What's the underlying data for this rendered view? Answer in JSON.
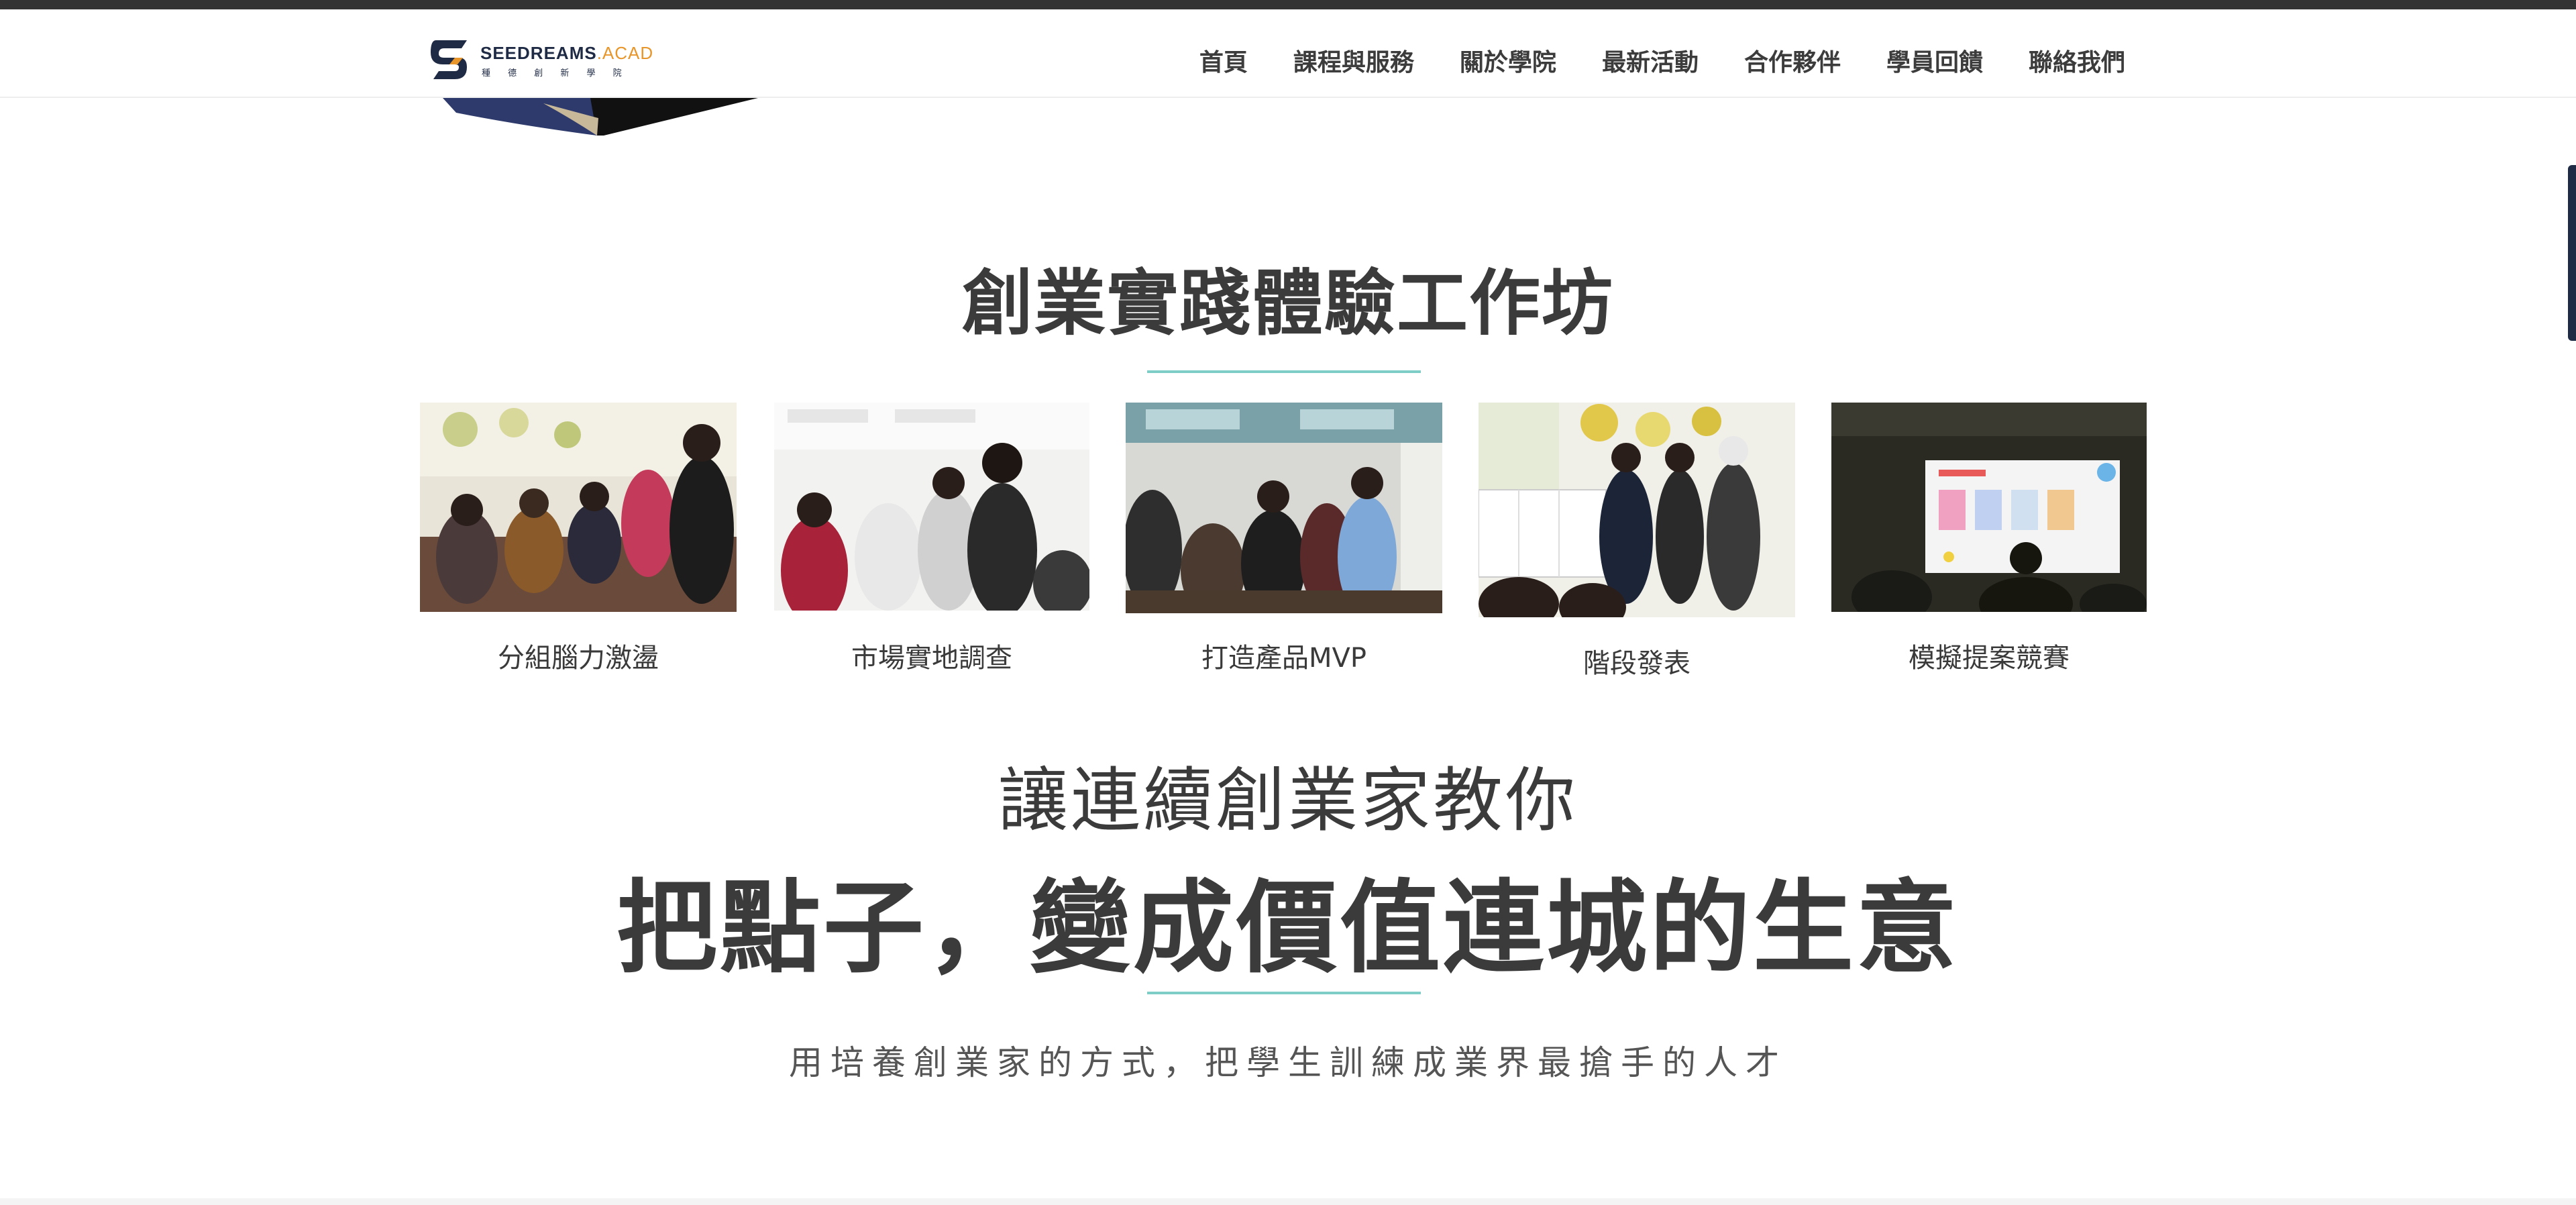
{
  "brand": {
    "name_main": "SEEDREAMS",
    "name_accent": ".ACAD",
    "sub": "種 德 創 新 學 院",
    "colors": {
      "navy": "#1f2a44",
      "orange": "#e8962a",
      "accent_line": "#7ecdc6"
    }
  },
  "nav": {
    "items": [
      "首頁",
      "課程與服務",
      "關於學院",
      "最新活動",
      "合作夥伴",
      "學員回饋",
      "聯絡我們"
    ]
  },
  "workshop": {
    "title": "創業實踐體驗工作坊",
    "items": [
      {
        "caption": "分組腦力激盪",
        "image": "group-brainstorm-photo"
      },
      {
        "caption": "市場實地調查",
        "image": "market-research-photo"
      },
      {
        "caption": "打造產品MVP",
        "image": "build-mvp-photo"
      },
      {
        "caption": "階段發表",
        "image": "stage-presentation-photo"
      },
      {
        "caption": "模擬提案競賽",
        "image": "pitch-competition-photo"
      }
    ]
  },
  "intro": {
    "sub_heading": "讓連續創業家教你",
    "main_heading": "把點子，變成價值連城的生意",
    "tagline": "用培養創業家的方式，把學生訓練成業界最搶手的人才"
  }
}
